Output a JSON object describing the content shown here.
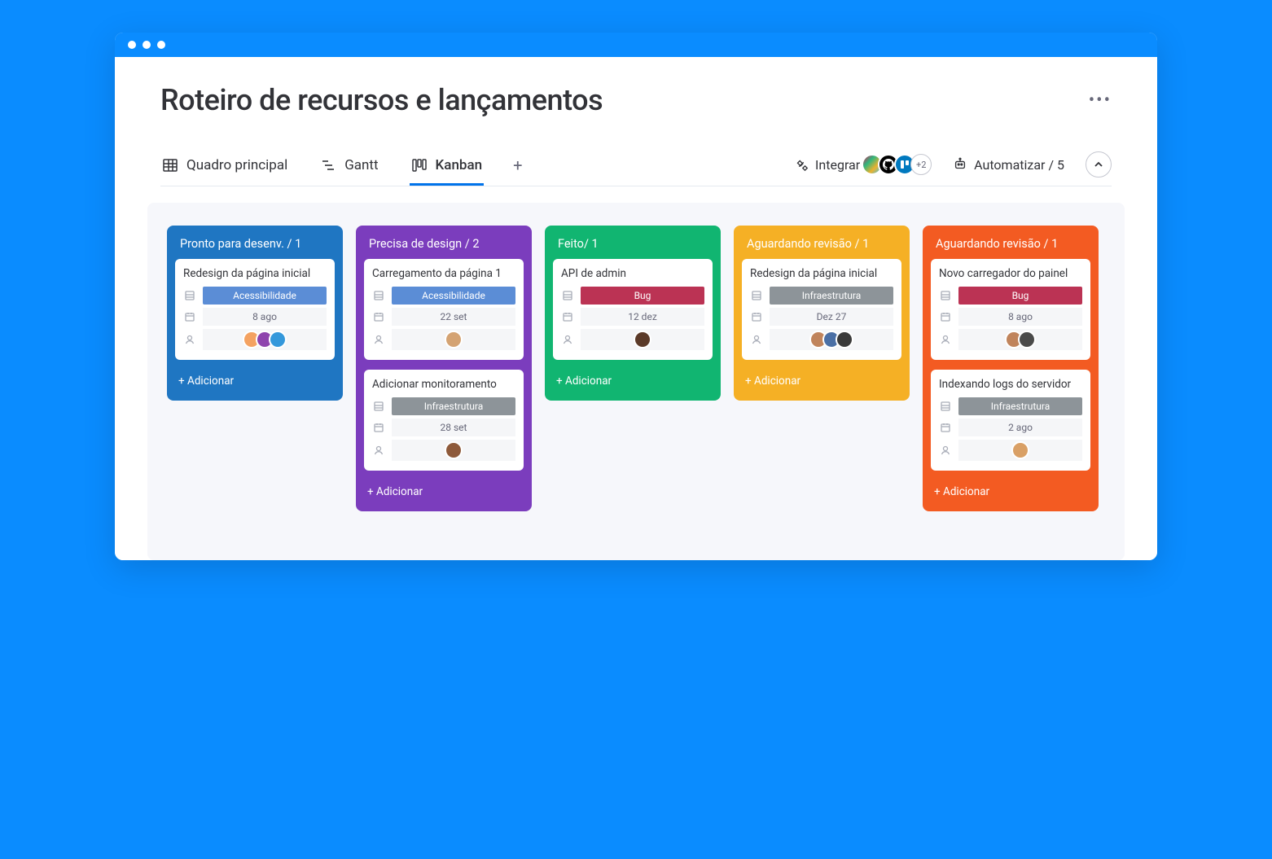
{
  "page_title": "Roteiro de recursos e lançamentos",
  "tabs": {
    "main": "Quadro principal",
    "gantt": "Gantt",
    "kanban": "Kanban"
  },
  "toolbar": {
    "integrate": "Integrar",
    "automate": "Automatizar / 5",
    "integrations_more": "+2"
  },
  "columns": [
    {
      "id": "ready",
      "color": "#1f76c2",
      "header": "Pronto para desenv. / 1",
      "add": "+ Adicionar",
      "cards": [
        {
          "title": "Redesign da página inicial",
          "tag": {
            "label": "Acessibilidade",
            "class": "access"
          },
          "date": "8 ago",
          "avatars": [
            "#f4a261",
            "#8e44ad",
            "#3498db"
          ]
        }
      ]
    },
    {
      "id": "design",
      "color": "#7b3dbd",
      "header": "Precisa de design / 2",
      "add": "+ Adicionar",
      "cards": [
        {
          "title": "Carregamento da página 1",
          "tag": {
            "label": "Acessibilidade",
            "class": "access"
          },
          "date": "22 set",
          "avatars": [
            "#d4a373"
          ]
        },
        {
          "title": "Adicionar monitoramento",
          "tag": {
            "label": "Infraestrutura",
            "class": "infra"
          },
          "date": "28 set",
          "avatars": [
            "#8e5a3b"
          ]
        }
      ]
    },
    {
      "id": "done",
      "color": "#11b571",
      "header": "Feito/ 1",
      "add": "+ Adicionar",
      "cards": [
        {
          "title": "API de admin",
          "tag": {
            "label": "Bug",
            "class": "bug"
          },
          "date": "12 dez",
          "avatars": [
            "#5b3a29"
          ]
        }
      ]
    },
    {
      "id": "review1",
      "color": "#f5b025",
      "header": "Aguardando revisão / 1",
      "add": "+ Adicionar",
      "cards": [
        {
          "title": "Redesign da página inicial",
          "tag": {
            "label": "Infraestrutura",
            "class": "infra"
          },
          "date": "Dez 27",
          "avatars": [
            "#c0845c",
            "#4a6fa5",
            "#3a3a3a"
          ]
        }
      ]
    },
    {
      "id": "review2",
      "color": "#f35b22",
      "header": "Aguardando revisão / 1",
      "add": "+ Adicionar",
      "cards": [
        {
          "title": "Novo carregador do painel",
          "tag": {
            "label": "Bug",
            "class": "bug"
          },
          "date": "8 ago",
          "avatars": [
            "#c0845c",
            "#4a4a4a"
          ]
        },
        {
          "title": "Indexando logs do servidor",
          "tag": {
            "label": "Infraestrutura",
            "class": "infra"
          },
          "date": "2 ago",
          "avatars": [
            "#d9a066"
          ]
        }
      ]
    }
  ]
}
